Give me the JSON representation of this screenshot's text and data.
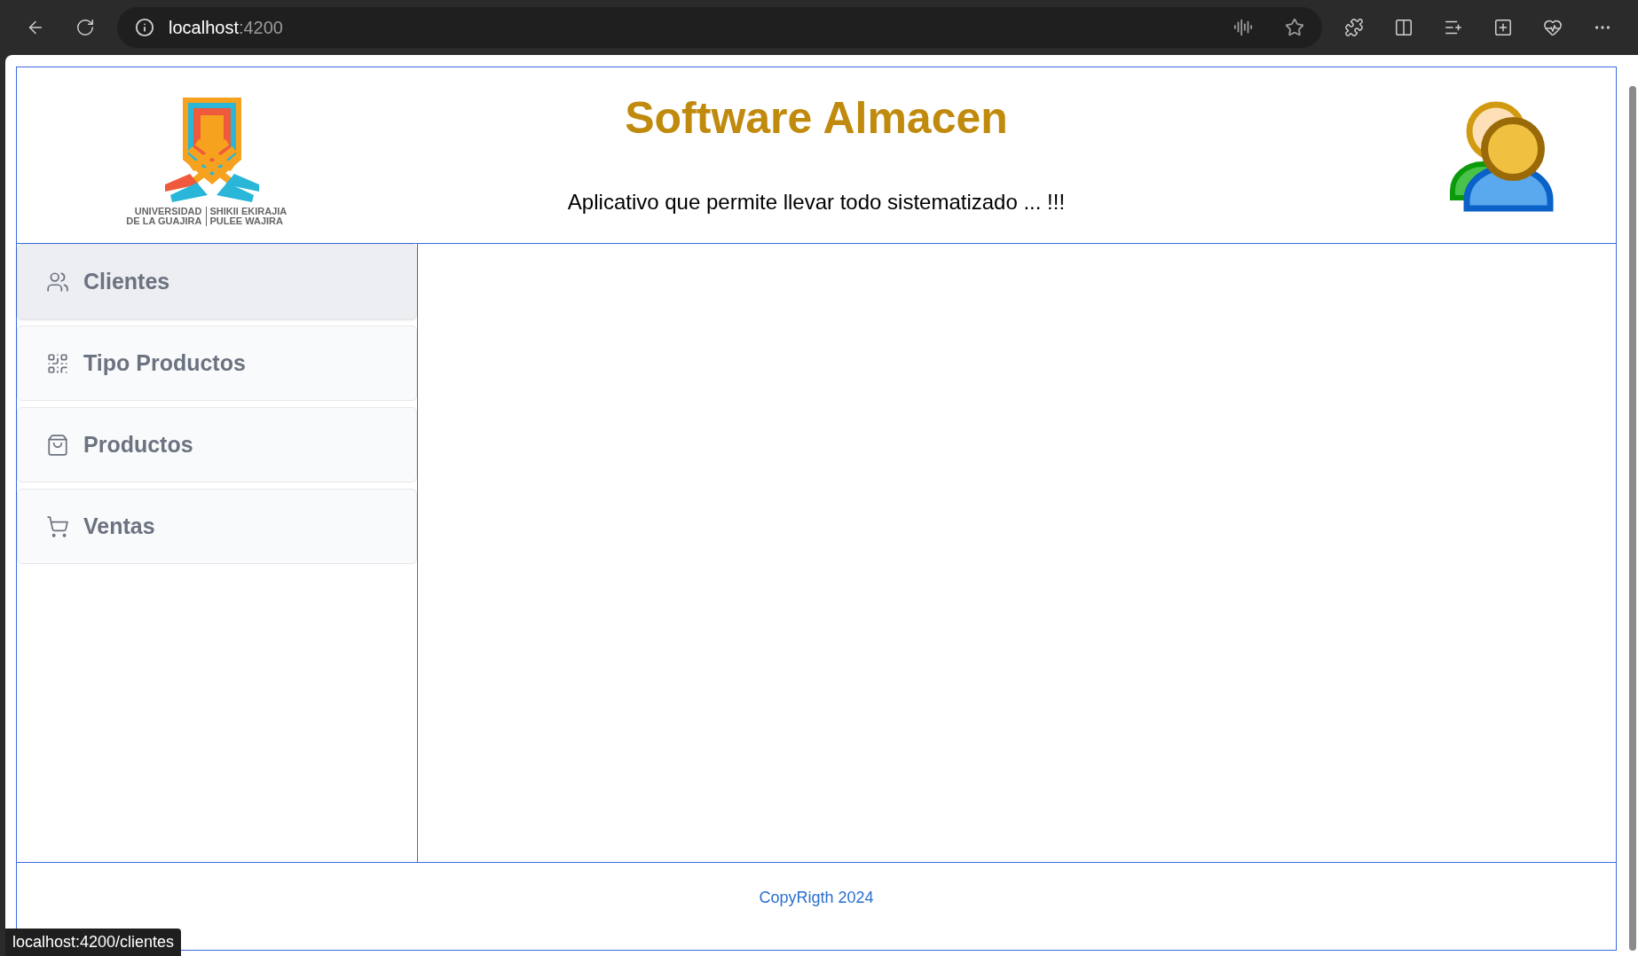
{
  "browser": {
    "url_host": "localhost",
    "url_port": ":4200"
  },
  "header": {
    "title": "Software Almacen",
    "subtitle": "Aplicativo que permite llevar todo sistematizado ... !!!",
    "logo_lines": [
      [
        "UNIVERSIDAD",
        "SHIKII EKIRAJIA"
      ],
      [
        "DE LA GUAJIRA",
        "PULEE  WAJIRA"
      ]
    ]
  },
  "sidebar": {
    "items": [
      {
        "label": "Clientes",
        "kind": "users",
        "hovered": true
      },
      {
        "label": "Tipo Productos",
        "kind": "grid",
        "hovered": false
      },
      {
        "label": "Productos",
        "kind": "bag",
        "hovered": false
      },
      {
        "label": "Ventas",
        "kind": "cart",
        "hovered": false
      }
    ]
  },
  "footer": {
    "text": "CopyRigth 2024"
  },
  "status_bar": {
    "url": "localhost:4200/clientes"
  }
}
